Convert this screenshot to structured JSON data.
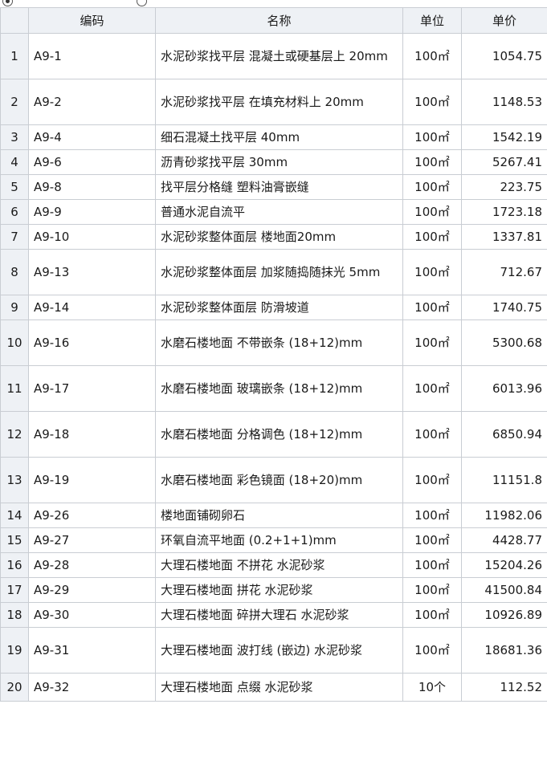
{
  "table": {
    "columns": [
      "",
      "编码",
      "名称",
      "单位",
      "单价"
    ],
    "rows": [
      {
        "idx": "1",
        "code": "A9-1",
        "name": "水泥砂浆找平层 混凝土或硬基层上 20mm",
        "unit": "100㎡",
        "price": "1054.75",
        "h": "h2"
      },
      {
        "idx": "2",
        "code": "A9-2",
        "name": "水泥砂浆找平层 在填充材料上 20mm",
        "unit": "100㎡",
        "price": "1148.53",
        "h": "h2"
      },
      {
        "idx": "3",
        "code": "A9-4",
        "name": "细石混凝土找平层 40mm",
        "unit": "100㎡",
        "price": "1542.19",
        "h": "h1"
      },
      {
        "idx": "4",
        "code": "A9-6",
        "name": "沥青砂浆找平层 30mm",
        "unit": "100㎡",
        "price": "5267.41",
        "h": "h1"
      },
      {
        "idx": "5",
        "code": "A9-8",
        "name": "找平层分格缝 塑料油膏嵌缝",
        "unit": "100㎡",
        "price": "223.75",
        "h": "h1"
      },
      {
        "idx": "6",
        "code": "A9-9",
        "name": "普通水泥自流平",
        "unit": "100㎡",
        "price": "1723.18",
        "h": "h1"
      },
      {
        "idx": "7",
        "code": "A9-10",
        "name": "水泥砂浆整体面层 楼地面20mm",
        "unit": "100㎡",
        "price": "1337.81",
        "h": "h1"
      },
      {
        "idx": "8",
        "code": "A9-13",
        "name": "水泥砂浆整体面层 加浆随捣随抹光 5mm",
        "unit": "100㎡",
        "price": "712.67",
        "h": "h2"
      },
      {
        "idx": "9",
        "code": "A9-14",
        "name": "水泥砂浆整体面层 防滑坡道",
        "unit": "100㎡",
        "price": "1740.75",
        "h": "h1"
      },
      {
        "idx": "10",
        "code": "A9-16",
        "name": "水磨石楼地面 不带嵌条 (18+12)mm",
        "unit": "100㎡",
        "price": "5300.68",
        "h": "h2"
      },
      {
        "idx": "11",
        "code": "A9-17",
        "name": "水磨石楼地面 玻璃嵌条 (18+12)mm",
        "unit": "100㎡",
        "price": "6013.96",
        "h": "h2"
      },
      {
        "idx": "12",
        "code": "A9-18",
        "name": "水磨石楼地面 分格调色 (18+12)mm",
        "unit": "100㎡",
        "price": "6850.94",
        "h": "h2"
      },
      {
        "idx": "13",
        "code": "A9-19",
        "name": "水磨石楼地面 彩色镜面 (18+20)mm",
        "unit": "100㎡",
        "price": "11151.8",
        "h": "h2"
      },
      {
        "idx": "14",
        "code": "A9-26",
        "name": "楼地面铺砌卵石",
        "unit": "100㎡",
        "price": "11982.06",
        "h": "h1"
      },
      {
        "idx": "15",
        "code": "A9-27",
        "name": "环氧自流平地面 (0.2+1+1)mm",
        "unit": "100㎡",
        "price": "4428.77",
        "h": "h1"
      },
      {
        "idx": "16",
        "code": "A9-28",
        "name": "大理石楼地面 不拼花 水泥砂浆",
        "unit": "100㎡",
        "price": "15204.26",
        "h": "h1"
      },
      {
        "idx": "17",
        "code": "A9-29",
        "name": "大理石楼地面 拼花 水泥砂浆",
        "unit": "100㎡",
        "price": "41500.84",
        "h": "h1"
      },
      {
        "idx": "18",
        "code": "A9-30",
        "name": "大理石楼地面 碎拼大理石 水泥砂浆",
        "unit": "100㎡",
        "price": "10926.89",
        "h": "h1"
      },
      {
        "idx": "19",
        "code": "A9-31",
        "name": "大理石楼地面 波打线 (嵌边) 水泥砂浆",
        "unit": "100㎡",
        "price": "18681.36",
        "h": "h2"
      },
      {
        "idx": "20",
        "code": "A9-32",
        "name": "大理石楼地面 点缀 水泥砂浆",
        "unit": "10个",
        "price": "112.52",
        "h": "h3"
      }
    ]
  }
}
